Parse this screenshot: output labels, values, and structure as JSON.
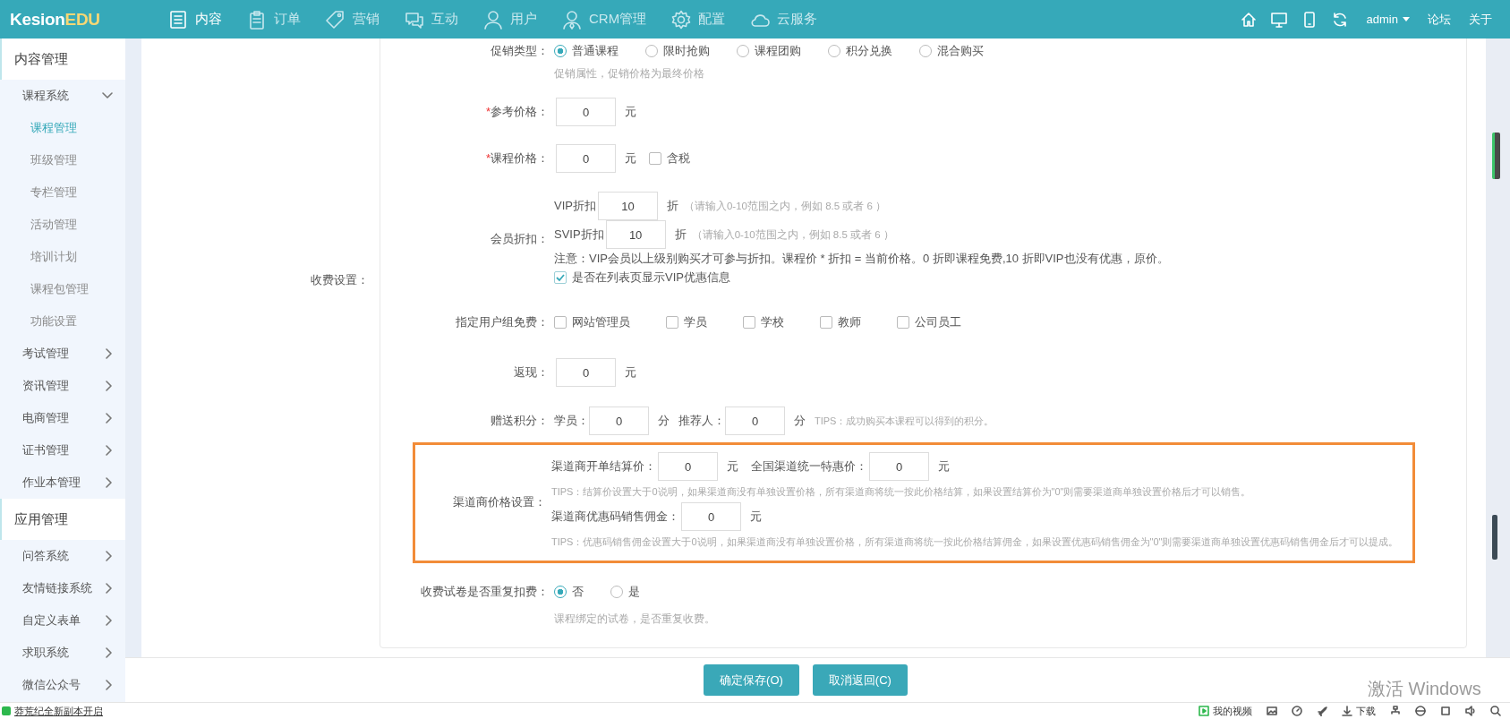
{
  "header": {
    "logo": {
      "main": "Kesion",
      "accent": "EDU"
    },
    "nav": [
      {
        "label": "内容",
        "selected": true
      },
      {
        "label": "订单",
        "selected": false
      },
      {
        "label": "营销",
        "selected": false
      },
      {
        "label": "互动",
        "selected": false
      },
      {
        "label": "用户",
        "selected": false
      },
      {
        "label": "CRM管理",
        "selected": false
      },
      {
        "label": "配置",
        "selected": false
      },
      {
        "label": "云服务",
        "selected": false
      }
    ],
    "user": "admin",
    "links": [
      "论坛",
      "关于"
    ]
  },
  "sidebar": {
    "groups": [
      {
        "title": "内容管理",
        "items": [
          {
            "label": "课程系统",
            "expanded": true,
            "selected": false,
            "children": [
              {
                "label": "课程管理",
                "selected": true
              },
              {
                "label": "班级管理",
                "selected": false
              },
              {
                "label": "专栏管理",
                "selected": false
              },
              {
                "label": "活动管理",
                "selected": false
              },
              {
                "label": "培训计划",
                "selected": false
              },
              {
                "label": "课程包管理",
                "selected": false
              },
              {
                "label": "功能设置",
                "selected": false
              }
            ]
          },
          {
            "label": "考试管理",
            "expanded": false,
            "selected": false
          },
          {
            "label": "资讯管理",
            "expanded": false,
            "selected": false
          },
          {
            "label": "电商管理",
            "expanded": false,
            "selected": false
          },
          {
            "label": "证书管理",
            "expanded": false,
            "selected": false
          },
          {
            "label": "作业本管理",
            "expanded": false,
            "selected": false
          }
        ]
      },
      {
        "title": "应用管理",
        "items": [
          {
            "label": "问答系统",
            "expanded": false,
            "selected": false
          },
          {
            "label": "友情链接系统",
            "expanded": false,
            "selected": false
          },
          {
            "label": "自定义表单",
            "expanded": false,
            "selected": false
          },
          {
            "label": "求职系统",
            "expanded": false,
            "selected": false
          },
          {
            "label": "微信公众号",
            "expanded": false,
            "selected": false
          }
        ]
      }
    ]
  },
  "form": {
    "section_label": "收费设置：",
    "promo_type": {
      "label": "促销类型：",
      "options": [
        {
          "label": "普通课程",
          "selected": true
        },
        {
          "label": "限时抢购",
          "selected": false
        },
        {
          "label": "课程团购",
          "selected": false
        },
        {
          "label": "积分兑换",
          "selected": false
        },
        {
          "label": "混合购买",
          "selected": false
        }
      ],
      "hint": "促销属性，促销价格为最终价格"
    },
    "ref_price": {
      "label": "参考价格：",
      "required_mark": "*",
      "value": "0",
      "unit": "元"
    },
    "course_price": {
      "label": "课程价格：",
      "required_mark": "*",
      "value": "0",
      "unit": "元",
      "tax": {
        "label": "含税",
        "checked": false
      }
    },
    "member_discount": {
      "label": "会员折扣：",
      "rows": [
        {
          "label": "VIP折扣",
          "value": "10",
          "unit": "折",
          "hint": "（请输入0-10范围之内，例如 8.5 或者 6 ）"
        },
        {
          "label": "SVIP折扣",
          "value": "10",
          "unit": "折",
          "hint": "（请输入0-10范围之内，例如 8.5 或者 6 ）"
        }
      ],
      "note": "注意：VIP会员以上级别购买才可参与折扣。课程价 * 折扣 = 当前价格。0 折即课程免费,10 折即VIP也没有优惠，原价。",
      "show_vip": {
        "label": "是否在列表页显示VIP优惠信息",
        "checked": true
      }
    },
    "free_groups": {
      "label": "指定用户组免费：",
      "options": [
        {
          "label": "网站管理员",
          "checked": false
        },
        {
          "label": "学员",
          "checked": false
        },
        {
          "label": "学校",
          "checked": false
        },
        {
          "label": "教师",
          "checked": false
        },
        {
          "label": "公司员工",
          "checked": false
        }
      ]
    },
    "cashback": {
      "label": "返现：",
      "value": "0",
      "unit": "元"
    },
    "points": {
      "label": "赠送积分：",
      "fields": [
        {
          "label": "学员：",
          "value": "0",
          "unit": "分"
        },
        {
          "label": "推荐人：",
          "value": "0",
          "unit": "分"
        }
      ],
      "tips": "TIPS：成功购买本课程可以得到的积分。"
    },
    "channel": {
      "label": "渠道商价格设置：",
      "highlighted": true,
      "lines": [
        {
          "fields": [
            {
              "label": "渠道商开单结算价：",
              "value": "0",
              "unit": "元"
            },
            {
              "label": "全国渠道统一特惠价：",
              "value": "0",
              "unit": "元"
            }
          ],
          "tips": "TIPS：结算价设置大于0说明，如果渠道商没有单独设置价格，所有渠道商将统一按此价格结算，如果设置结算价为\"0\"则需要渠道商单独设置价格后才可以销售。"
        },
        {
          "fields": [
            {
              "label": "渠道商优惠码销售佣金：",
              "value": "0",
              "unit": "元"
            }
          ],
          "tips": "TIPS：优惠码销售佣金设置大于0说明，如果渠道商没有单独设置价格，所有渠道商将统一按此价格结算佣金，如果设置优惠码销售佣金为\"0\"则需要渠道商单独设置优惠码销售佣金后才可以提成。"
        }
      ]
    },
    "paper_fee": {
      "label": "收费试卷是否重复扣费：",
      "options": [
        {
          "label": "否",
          "selected": true
        },
        {
          "label": "是",
          "selected": false
        }
      ],
      "hint": "课程绑定的试卷，是否重复收费。"
    }
  },
  "buttons": [
    {
      "label": "确定保存(O)"
    },
    {
      "label": "取消返回(C)"
    }
  ],
  "status_bar": {
    "news": "莽荒纪全新副本开启",
    "video": "我的视频",
    "download": "下载"
  },
  "windows_notice": "激活 Windows"
}
